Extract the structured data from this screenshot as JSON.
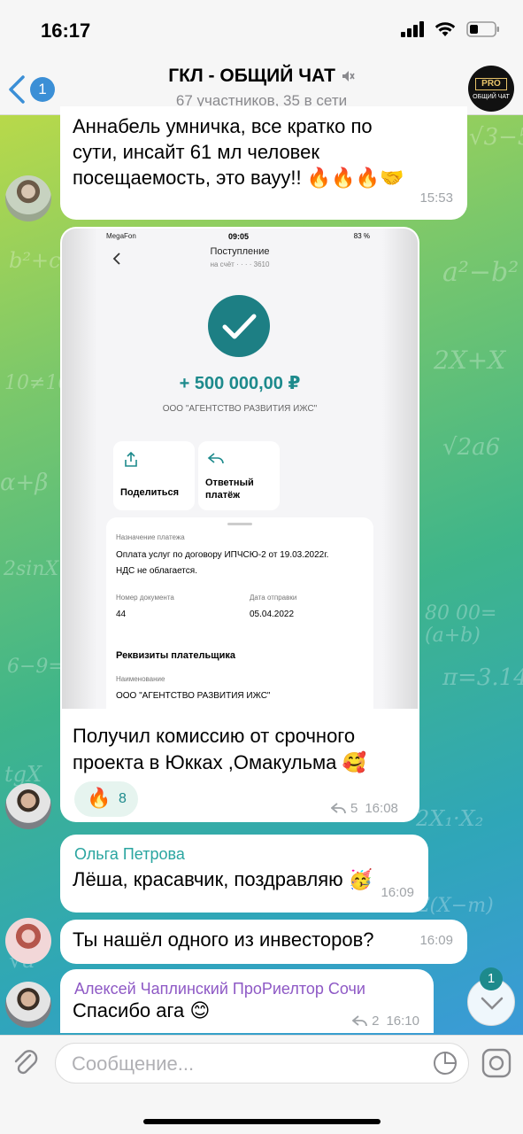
{
  "status": {
    "time": "16:17"
  },
  "header": {
    "back_badge": "1",
    "title": "ГКЛ - ОБЩИЙ ЧАТ",
    "subtitle": "67 участников, 35 в сети",
    "avatar_top": "PRO",
    "avatar_bottom": "ОБЩИЙ ЧАТ"
  },
  "messages": [
    {
      "text_lines": [
        "Аннабель умничка, все кратко по",
        "сути, инсайт 61 мл человек",
        "посещаемость, это вауу!! 🔥🔥🔥🤝"
      ],
      "time": "15:53"
    },
    {
      "receipt": {
        "carrier": "MegaFon",
        "time": "09:05",
        "battery": "83 %",
        "screen_title": "Поступление",
        "account": "на счёт · · · · 3610",
        "amount": "+ 500 000,00 ₽",
        "company": "ООО \"АГЕНТСТВО РАЗВИТИЯ ИЖС\"",
        "action_share": "Поделиться",
        "action_reply_1": "Ответный",
        "action_reply_2": "платёж",
        "purpose_label": "Назначение платежа",
        "purpose_line1": "Оплата услуг по договору ИПЧСЮ-2 от 19.03.2022г.",
        "purpose_line2": "НДС не облагается.",
        "doc_label": "Номер документа",
        "doc_value": "44",
        "date_label": "Дата отправки",
        "date_value": "05.04.2022",
        "payer_heading": "Реквизиты плательщика",
        "name_label": "Наименование",
        "name_value": "ООО \"АГЕНТСТВО РАЗВИТИЯ ИЖС\""
      },
      "text_lines": [
        "Получил комиссию от срочного",
        "проекта в Юкках ,Омакульма 🥰"
      ],
      "reaction_count": "8",
      "replies": "5",
      "time": "16:08"
    },
    {
      "sender": "Ольга Петрова",
      "text": "Лёша, красавчик, поздравляю 🥳",
      "time": "16:09"
    },
    {
      "text": "Ты нашёл одного из инвесторов?",
      "time": "16:09"
    },
    {
      "sender": "Алексей Чаплинский ПроРиелтор Сочи",
      "text": "Спасибо ага 😊",
      "replies": "2",
      "time": "16:10"
    }
  ],
  "scroll_badge": "1",
  "input": {
    "placeholder": "Сообщение..."
  },
  "colors": {
    "accent": "#3b8fd6",
    "teal": "#1d8a8c",
    "sender_olga": "#2aa5a0",
    "sender_alexey": "#8e59c5"
  }
}
